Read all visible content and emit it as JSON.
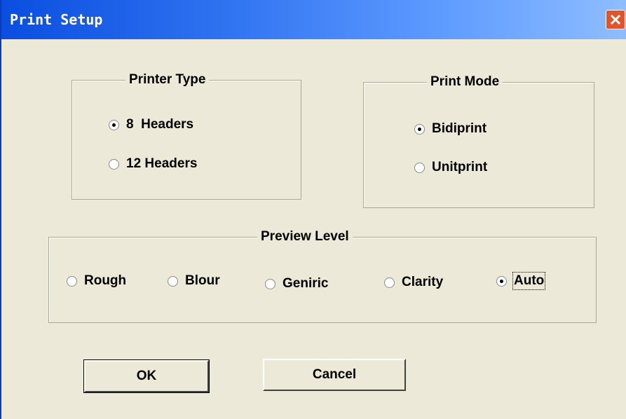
{
  "window": {
    "title": "Print Setup"
  },
  "printer_type": {
    "label": "Printer Type",
    "options": [
      {
        "label": "8  Headers",
        "selected": true
      },
      {
        "label": "12 Headers",
        "selected": false
      }
    ]
  },
  "print_mode": {
    "label": "Print Mode",
    "options": [
      {
        "label": "Bidiprint",
        "selected": true
      },
      {
        "label": "Unitprint",
        "selected": false
      }
    ]
  },
  "preview_level": {
    "label": "Preview Level",
    "options": [
      {
        "label": "Rough",
        "selected": false
      },
      {
        "label": "Blour",
        "selected": false
      },
      {
        "label": "Geniric",
        "selected": false
      },
      {
        "label": "Clarity",
        "selected": false
      },
      {
        "label": "Auto",
        "selected": true
      }
    ]
  },
  "buttons": {
    "ok_label": "OK",
    "cancel_label": "Cancel"
  },
  "colors": {
    "titlebar": "#0a4ee0",
    "face": "#ece9d8",
    "close": "#e0552c"
  }
}
